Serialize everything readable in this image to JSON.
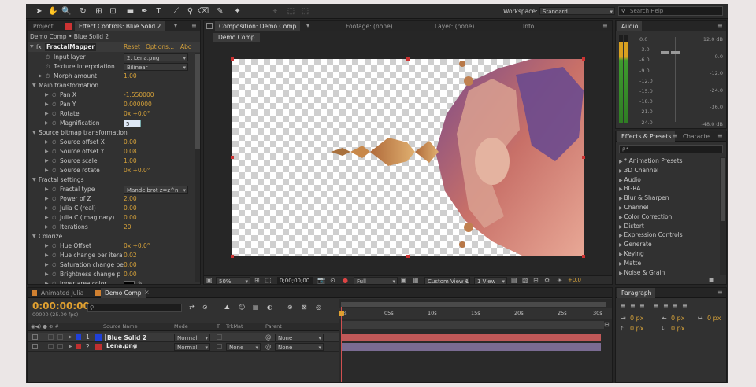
{
  "workspace": {
    "label": "Workspace:",
    "value": "Standard",
    "search_placeholder": "Search Help"
  },
  "left_panel": {
    "tabs": [
      "Project",
      "Effect Controls: Blue Solid 2"
    ],
    "breadcrumb": "Demo Comp • Blue Solid 2",
    "effect_name": "FractalMapper",
    "links": [
      "Reset",
      "Options...",
      "Abo"
    ],
    "props": [
      {
        "label": "Input layer",
        "type": "dropdown",
        "value": "2. Lena.png",
        "indent": 1
      },
      {
        "label": "Texture interpolation",
        "type": "dropdown",
        "value": "Bilinear",
        "indent": 1
      },
      {
        "label": "Morph amount",
        "type": "value",
        "value": "1.00",
        "indent": 1
      },
      {
        "label": "Main transformation",
        "type": "group",
        "indent": 0
      },
      {
        "label": "Pan X",
        "type": "value",
        "value": "-1.550000",
        "indent": 2
      },
      {
        "label": "Pan Y",
        "type": "value",
        "value": "0.000000",
        "indent": 2
      },
      {
        "label": "Rotate",
        "type": "value",
        "value": "0x +0.0°",
        "indent": 2
      },
      {
        "label": "Magnification",
        "type": "edit",
        "value": "5",
        "indent": 2
      },
      {
        "label": "Source bitmap transformation",
        "type": "group",
        "indent": 0
      },
      {
        "label": "Source offset X",
        "type": "value",
        "value": "0.00",
        "indent": 2
      },
      {
        "label": "Source offset Y",
        "type": "value",
        "value": "0.08",
        "indent": 2
      },
      {
        "label": "Source scale",
        "type": "value",
        "value": "1.00",
        "indent": 2
      },
      {
        "label": "Source rotate",
        "type": "value",
        "value": "0x +0.0°",
        "indent": 2
      },
      {
        "label": "Fractal settings",
        "type": "group",
        "indent": 0
      },
      {
        "label": "Fractal type",
        "type": "dropdown",
        "value": "Mandelbrot z=z^n",
        "indent": 2
      },
      {
        "label": "Power of Z",
        "type": "value",
        "value": "2.00",
        "indent": 2
      },
      {
        "label": "Julia C (real)",
        "type": "value",
        "value": "0.00",
        "indent": 2
      },
      {
        "label": "Julia C (imaginary)",
        "type": "value",
        "value": "0.00",
        "indent": 2
      },
      {
        "label": "Iterations",
        "type": "value",
        "value": "20",
        "indent": 2
      },
      {
        "label": "Colorize",
        "type": "group",
        "indent": 0
      },
      {
        "label": "Hue Offset",
        "type": "value",
        "value": "0x +0.0°",
        "indent": 2
      },
      {
        "label": "Hue change per itera",
        "type": "value",
        "value": "0.02",
        "indent": 2
      },
      {
        "label": "Saturation change pe",
        "type": "value",
        "value": "0.00",
        "indent": 2
      },
      {
        "label": "Brightness change p",
        "type": "value",
        "value": "0.00",
        "indent": 2
      },
      {
        "label": "Inner area color",
        "type": "color",
        "value": "",
        "indent": 2
      }
    ]
  },
  "comp_panel": {
    "tabs": [
      "Composition: Demo Comp",
      "Footage: (none)",
      "Layer: (none)",
      "Info"
    ],
    "subtab": "Demo Comp",
    "zoom": "50%",
    "timecode": "0;00;00;00",
    "resolution": "Full",
    "view": "Custom View 1",
    "views": "1 View",
    "exposure": "+0.0"
  },
  "audio": {
    "title": "Audio",
    "left_scale": [
      "0.0",
      "-3.0",
      "-6.0",
      "-9.0",
      "-12.0",
      "-15.0",
      "-18.0",
      "-21.0",
      "-24.0"
    ],
    "right_scale": [
      "12.0 dB",
      "0.0",
      "-12.0",
      "-24.0",
      "-36.0",
      "-48.0 dB"
    ],
    "level": 0.92
  },
  "effects_presets": {
    "tabs": [
      "Effects & Presets",
      "Characte"
    ],
    "search_placeholder": "ρ•",
    "items": [
      "* Animation Presets",
      "3D Channel",
      "Audio",
      "BGRA",
      "Blur & Sharpen",
      "Channel",
      "Color Correction",
      "Distort",
      "Expression Controls",
      "Generate",
      "Keying",
      "Matte",
      "Noise & Grain"
    ]
  },
  "timeline": {
    "tabs": [
      "Animated Julia",
      "Demo Comp"
    ],
    "timecode": "0:00:00:00",
    "fps": "00000 (25.00 fps)",
    "columns": [
      "Source Name",
      "Mode",
      "T",
      "TrkMat",
      "Parent"
    ],
    "layers": [
      {
        "num": "1",
        "name": "Blue Solid 2",
        "mode": "Normal",
        "trkmat": "",
        "parent": "None",
        "label_color": "#2040d8",
        "bar_color": "#c05858"
      },
      {
        "num": "2",
        "name": "Lena.png",
        "mode": "Normal",
        "trkmat": "None",
        "parent": "None",
        "label_color": "#c03030",
        "bar_color": "#7a6b92"
      }
    ],
    "ruler": [
      "0s",
      "05s",
      "10s",
      "15s",
      "20s",
      "25s",
      "30s"
    ]
  },
  "paragraph": {
    "title": "Paragraph",
    "fields": [
      "0 px",
      "0 px",
      "0 px",
      "0 px",
      "0 px"
    ]
  },
  "colors": {
    "accent": "#d6a23a",
    "playhead": "#d05050"
  }
}
